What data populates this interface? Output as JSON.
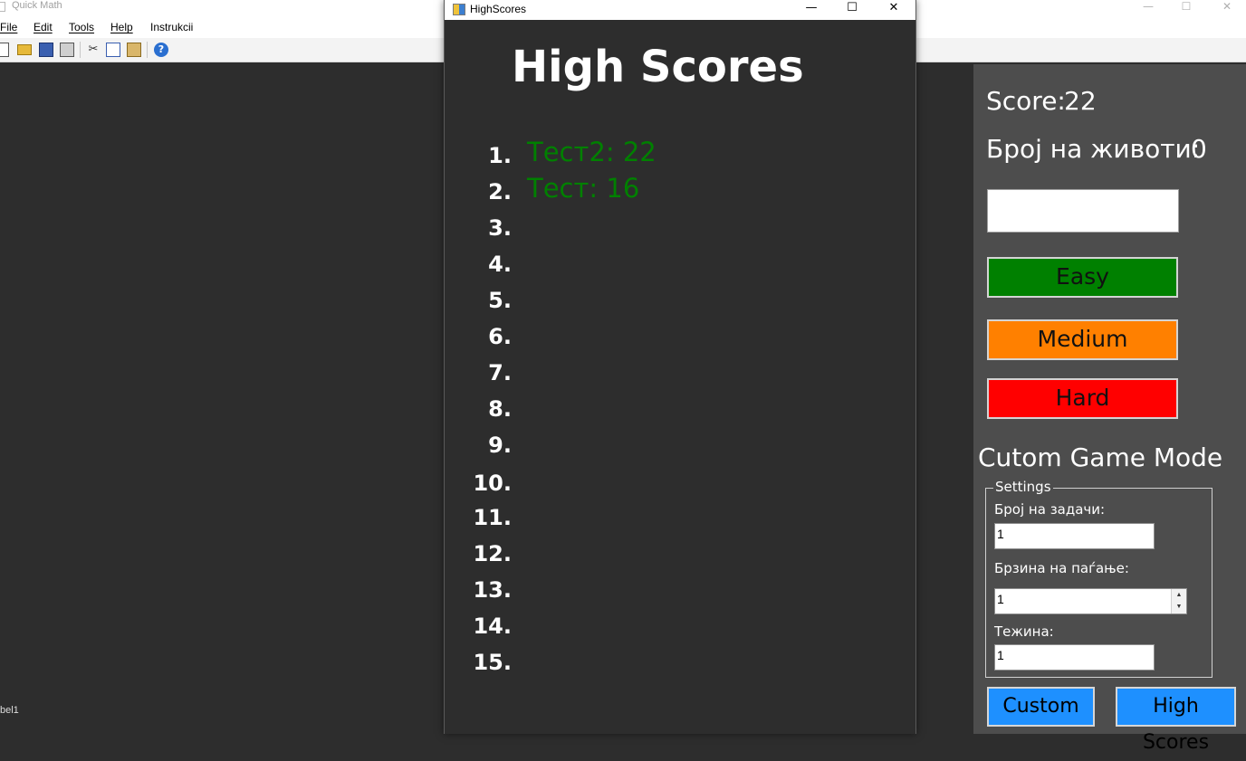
{
  "main_window": {
    "title": "Quick Math",
    "menu": [
      "File",
      "Edit",
      "Tools",
      "Help",
      "Instrukcii"
    ],
    "toolbar_icons": [
      "new-file-icon",
      "open-folder-icon",
      "save-icon",
      "print-icon",
      "cut-icon",
      "copy-icon",
      "paste-icon",
      "help-icon"
    ],
    "status_label": "bel1"
  },
  "game_panel": {
    "score_label": "Score:",
    "score_value": "22",
    "lives_label": "Број на животи:",
    "lives_value": "0",
    "answer_value": "",
    "easy_label": "Easy",
    "medium_label": "Medium",
    "hard_label": "Hard",
    "colors": {
      "easy": "#008000",
      "medium": "#ff8000",
      "hard": "#ff0000",
      "button_blue": "#1e90ff"
    }
  },
  "custom_mode": {
    "title": "Cutom Game Mode",
    "group_label": "Settings",
    "tasks_label": "Број на задачи:",
    "tasks_value": "1",
    "speed_label": "Брзина на паѓање:",
    "speed_value": "1",
    "difficulty_label": "Тежина:",
    "difficulty_value": "1",
    "custom_button": "Custom",
    "highscores_button": "High Scores"
  },
  "highscores_window": {
    "title": "HighScores",
    "heading": "High Scores",
    "ranks": [
      "1.",
      "2.",
      "3.",
      "4.",
      "5.",
      "6.",
      "7.",
      "8.",
      "9.",
      "10.",
      "11.",
      "12.",
      "13.",
      "14.",
      "15."
    ],
    "entries": [
      "Тест2: 22",
      "Тест: 16"
    ]
  }
}
